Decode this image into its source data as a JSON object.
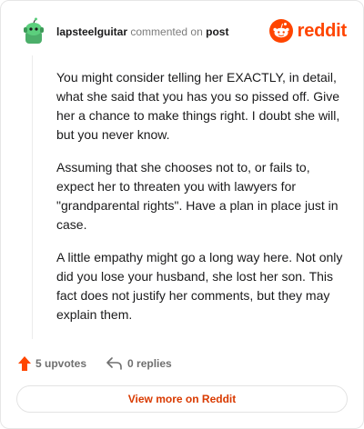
{
  "header": {
    "username": "lapsteelguitar",
    "action_text": "commented on",
    "post_link": "post",
    "brand": "reddit"
  },
  "comment": {
    "paragraphs": [
      "You might consider telling her EXACTLY, in detail, what she said that you has you so pissed off. Give her a chance to make things right. I doubt she will, but you never know.",
      "Assuming that she chooses not to, or fails to, expect her to threaten you with lawyers for \"grandparental rights\". Have a plan in place just in case.",
      "A little empathy might go a long way here. Not only did you lose your husband, she lost her son. This fact does not justify her comments, but they may explain them."
    ]
  },
  "footer": {
    "upvotes": "5 upvotes",
    "replies": "0 replies",
    "view_more": "View more on Reddit"
  },
  "colors": {
    "accent": "#ff4500",
    "link_text": "#d93a00",
    "avatar_bg": "#54c77a"
  },
  "icons": {
    "avatar": "snoo-avatar-icon",
    "logo": "reddit-logo-icon",
    "upvote": "upvote-arrow-icon",
    "reply": "reply-arrow-icon"
  }
}
